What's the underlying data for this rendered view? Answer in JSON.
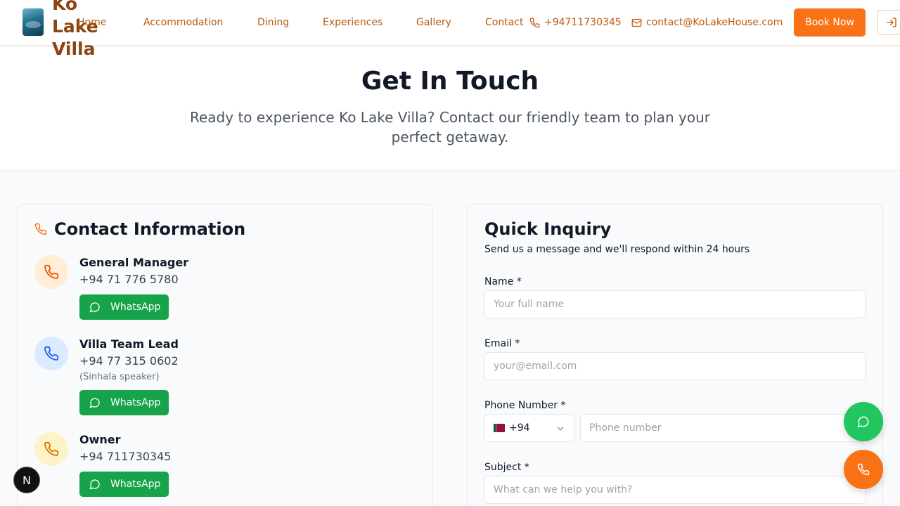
{
  "header": {
    "logo_text": "Ko Lake Villa",
    "nav": [
      {
        "label": "Home"
      },
      {
        "label": "Accommodation"
      },
      {
        "label": "Dining"
      },
      {
        "label": "Experiences"
      },
      {
        "label": "Gallery"
      },
      {
        "label": "Contact"
      }
    ],
    "phone": "+94711730345",
    "email": "contact@KoLakeHouse.com",
    "book_label": "Book Now",
    "brand_color": "#f97316"
  },
  "hero": {
    "title": "Get In Touch",
    "subtitle": "Ready to experience Ko Lake Villa? Contact our friendly team to plan your perfect getaway."
  },
  "contact_info": {
    "title": "Contact Information",
    "contacts": [
      {
        "name": "General Manager",
        "phone": "+94 71 776 5780",
        "note": "",
        "button": "WhatsApp"
      },
      {
        "name": "Villa Team Lead",
        "phone": "+94 77 315 0602",
        "note": "(Sinhala speaker)",
        "button": "WhatsApp"
      },
      {
        "name": "Owner",
        "phone": "+94 711730345",
        "note": "",
        "button": "WhatsApp"
      }
    ],
    "whatsapp_color": "#16a34a"
  },
  "inquiry": {
    "title": "Quick Inquiry",
    "subtitle": "Send us a message and we'll respond within 24 hours",
    "name_label": "Name *",
    "name_placeholder": "Your full name",
    "email_label": "Email *",
    "email_placeholder": "your@email.com",
    "phone_label": "Phone Number *",
    "country_code": "+94",
    "phone_placeholder": "Phone number",
    "subject_label": "Subject *",
    "subject_placeholder": "What can we help you with?"
  },
  "badge": {
    "letter": "N"
  }
}
